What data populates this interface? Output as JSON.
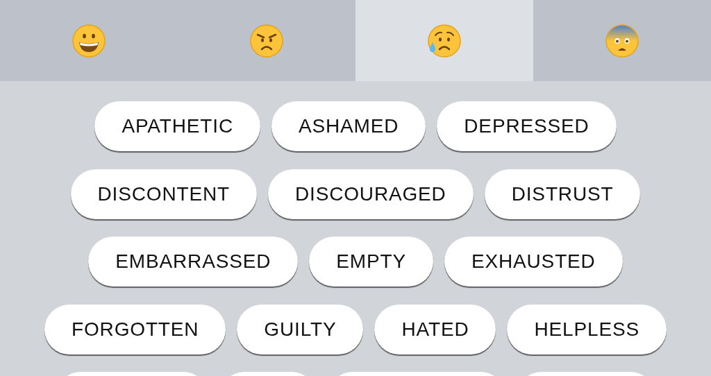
{
  "tabs": [
    {
      "kind": "grinning",
      "selected": false
    },
    {
      "kind": "angry",
      "selected": false
    },
    {
      "kind": "sad-sweat",
      "selected": true
    },
    {
      "kind": "fearful",
      "selected": false
    }
  ],
  "tag_rows": [
    [
      {
        "kind": "tag",
        "label": "APATHETIC"
      },
      {
        "kind": "tag",
        "label": "ASHAMED"
      },
      {
        "kind": "tag",
        "label": "DEPRESSED"
      }
    ],
    [
      {
        "kind": "tag",
        "label": "DISCONTENT"
      },
      {
        "kind": "tag",
        "label": "DISCOURAGED"
      },
      {
        "kind": "tag",
        "label": "DISTRUST"
      }
    ],
    [
      {
        "kind": "tag",
        "label": "EMBARRASSED"
      },
      {
        "kind": "tag",
        "label": "EMPTY"
      },
      {
        "kind": "tag",
        "label": "EXHAUSTED"
      }
    ],
    [
      {
        "kind": "tag",
        "label": "FORGOTTEN"
      },
      {
        "kind": "tag",
        "label": "GUILTY"
      },
      {
        "kind": "tag",
        "label": "HATED"
      },
      {
        "kind": "tag",
        "label": "HELPLESS"
      }
    ],
    [
      {
        "kind": "cut"
      },
      {
        "kind": "cut"
      },
      {
        "kind": "cut"
      },
      {
        "kind": "cut"
      }
    ]
  ]
}
